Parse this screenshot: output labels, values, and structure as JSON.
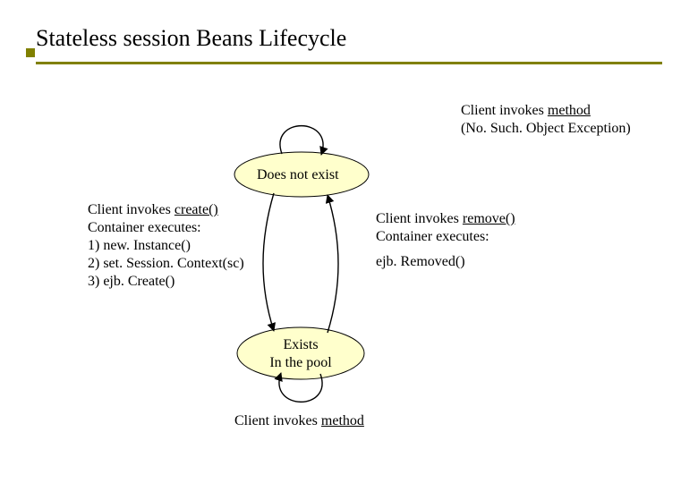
{
  "title": "Stateless session Beans Lifecycle",
  "nodes": {
    "does_not_exist": "Does not exist",
    "exists_line1": "Exists",
    "exists_line2": "In the pool"
  },
  "top_self": {
    "line1_a": "Client invokes ",
    "line1_b": "method",
    "line2": "(No. Such. Object Exception)"
  },
  "left_trans": {
    "line1_a": "Client invokes ",
    "line1_b": "create()",
    "line2": "Container executes:",
    "i1": "1)    new. Instance()",
    "i2": "2)    set. Session. Context(sc)",
    "i3": "3)    ejb. Create()"
  },
  "right_trans": {
    "line1_a": "Client invokes ",
    "line1_b": "remove()",
    "line2": "Container executes:",
    "i1": "ejb. Removed()"
  },
  "bottom_self": {
    "a": "Client invokes ",
    "b": "method"
  }
}
